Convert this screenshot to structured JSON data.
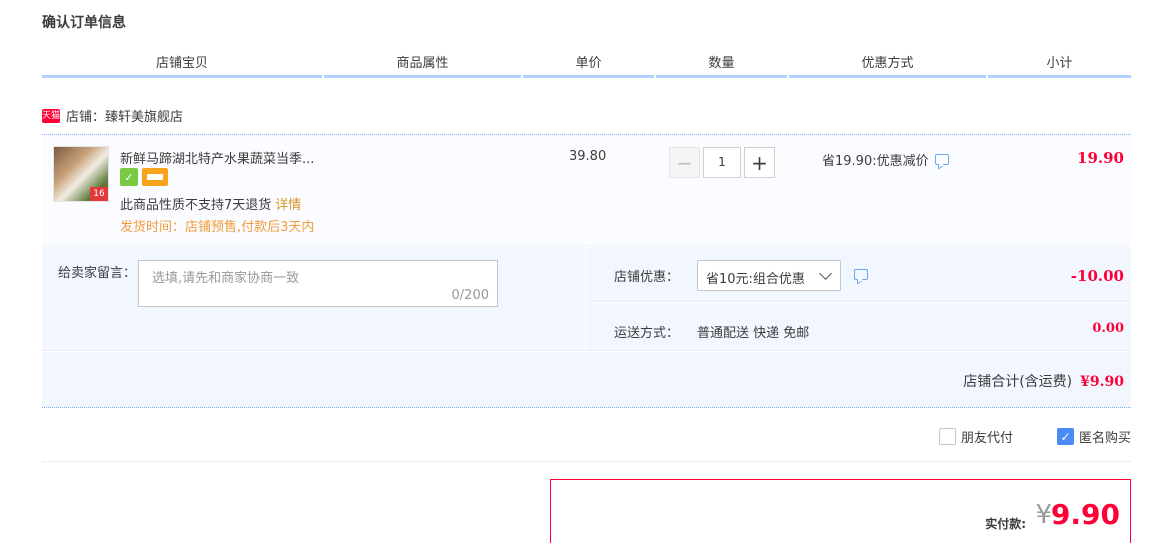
{
  "page_title": "确认订单信息",
  "columns": [
    "店铺宝贝",
    "商品属性",
    "单价",
    "数量",
    "优惠方式",
    "小计"
  ],
  "shop": {
    "badge": "天猫",
    "label": "店铺：",
    "name": "臻轩美旗舰店"
  },
  "item": {
    "title": "新鲜马蹄湖北特产水果蔬菜当季...",
    "thumb_label": "16",
    "no_return": "此商品性质不支持7天退货",
    "detail_link": "详情",
    "ship_time": "发货时间：店铺预售,付款后3天内",
    "unit_price": "39.80",
    "quantity": "1",
    "promo": "省19.90:优惠减价",
    "subtotal": "19.90"
  },
  "message": {
    "label": "给卖家留言：",
    "placeholder": "选填,请先和商家协商一致",
    "counter": "0/200"
  },
  "coupon": {
    "label": "店铺优惠：",
    "selected": "省10元:组合优惠",
    "amount": "-10.00"
  },
  "shipping": {
    "label": "运送方式：",
    "method": "普通配送 快递 免邮",
    "amount": "0.00"
  },
  "shop_total": {
    "label": "店铺合计(含运费)",
    "amount": "¥9.90"
  },
  "options": [
    {
      "label": "朋友代付",
      "checked": false
    },
    {
      "label": "匿名购买",
      "checked": true
    }
  ],
  "payment": {
    "label": "实付款:",
    "currency": "¥",
    "amount": "9.90"
  },
  "colors": {
    "accent": "#ff0036",
    "header_line": "#b2d1ff",
    "panel_bg": "#f2f7ff",
    "checkbox_on": "#4a8bf5"
  }
}
